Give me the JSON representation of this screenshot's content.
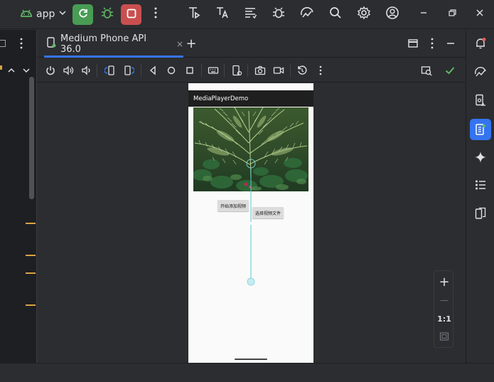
{
  "titlebar": {
    "run_config": "app",
    "icons": [
      "android-icon",
      "chevron-down-icon",
      "apply-changes-icon",
      "debug-icon",
      "stop-icon",
      "more-vertical-icon",
      "profiler-icon",
      "translate-icon",
      "build-variants-icon",
      "bug-settings-icon",
      "device-explorer-icon",
      "search-icon",
      "settings-icon",
      "account-icon",
      "minimize-icon",
      "restore-icon",
      "close-icon"
    ]
  },
  "tabs": {
    "device_tab_label": "Medium Phone API 36.0",
    "close_glyph": "×",
    "add_glyph": "+"
  },
  "emulator_toolbar": {
    "icons": [
      "power-icon",
      "volume-up-icon",
      "volume-down-icon",
      "rotate-left-icon",
      "rotate-right-icon",
      "back-icon",
      "home-icon",
      "overview-icon",
      "keyboard-icon",
      "snapshot-settings-icon",
      "camera-icon",
      "record-icon",
      "rewind-icon",
      "more-vertical-icon",
      "layout-inspector-icon",
      "check-icon"
    ]
  },
  "phone": {
    "app_title": "MediaPlayerDemo",
    "button_start_label": "开始添加视频",
    "button_choose_label": "选择视频文件"
  },
  "zoom": {
    "plus": "+",
    "minus": "—",
    "ratio": "1:1"
  },
  "right_bar": {
    "icons": [
      "notifications-icon",
      "gradle-icon",
      "device-manager-icon",
      "running-devices-icon",
      "gemini-icon",
      "structure-icon",
      "device-mirroring-icon"
    ]
  },
  "colors": {
    "accent": "#3574f0",
    "run_green": "#499c54",
    "stop_red": "#c94f4f",
    "marker": "#d9a343",
    "check": "#5fb865"
  }
}
